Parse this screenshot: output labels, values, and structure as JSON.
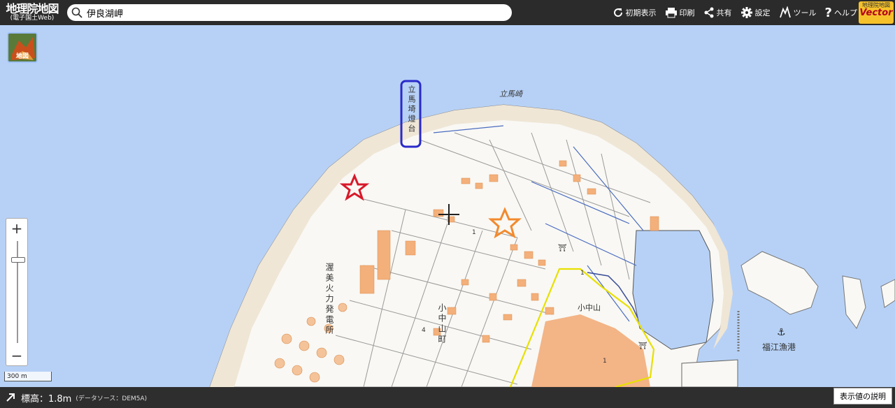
{
  "header": {
    "logo_main": "地理院地図",
    "logo_sub": "(電子国土Web)",
    "search_value": "伊良湖岬",
    "tools": [
      {
        "label": "初期表示",
        "icon": "refresh-icon"
      },
      {
        "label": "印刷",
        "icon": "print-icon"
      },
      {
        "label": "共有",
        "icon": "share-icon"
      },
      {
        "label": "設定",
        "icon": "gear-icon"
      },
      {
        "label": "ツール",
        "icon": "tool-icon"
      },
      {
        "label": "ヘルプ",
        "icon": "help-icon"
      }
    ],
    "vector_logo_top": "地理院地図",
    "vector_logo_bottom": "Vector"
  },
  "layer_button": {
    "label": "地図"
  },
  "zoom": {
    "plus": "+",
    "minus": "−"
  },
  "scale_label": "300 m",
  "map_labels": {
    "lighthouse": "立馬埼燈台",
    "cape": "立馬崎",
    "power_plant": "渥美火力発電所",
    "town": "小中山町",
    "district": "小中山",
    "port": "福江漁港",
    "num1": "1",
    "num2": "1",
    "num3": "4",
    "num4": "1"
  },
  "footer": {
    "elevation": "標高：1.8m",
    "source": "(データソース：DEM5A)",
    "explain_button": "表示値の説明"
  },
  "colors": {
    "sea": "#b7d1f6",
    "land": "#f9f8f4",
    "buildings": "#f4b07a",
    "boundary": "#e8e000",
    "marker_red": "#d8192a",
    "marker_orange": "#f28a2e",
    "label_box": "#2a2acb"
  }
}
